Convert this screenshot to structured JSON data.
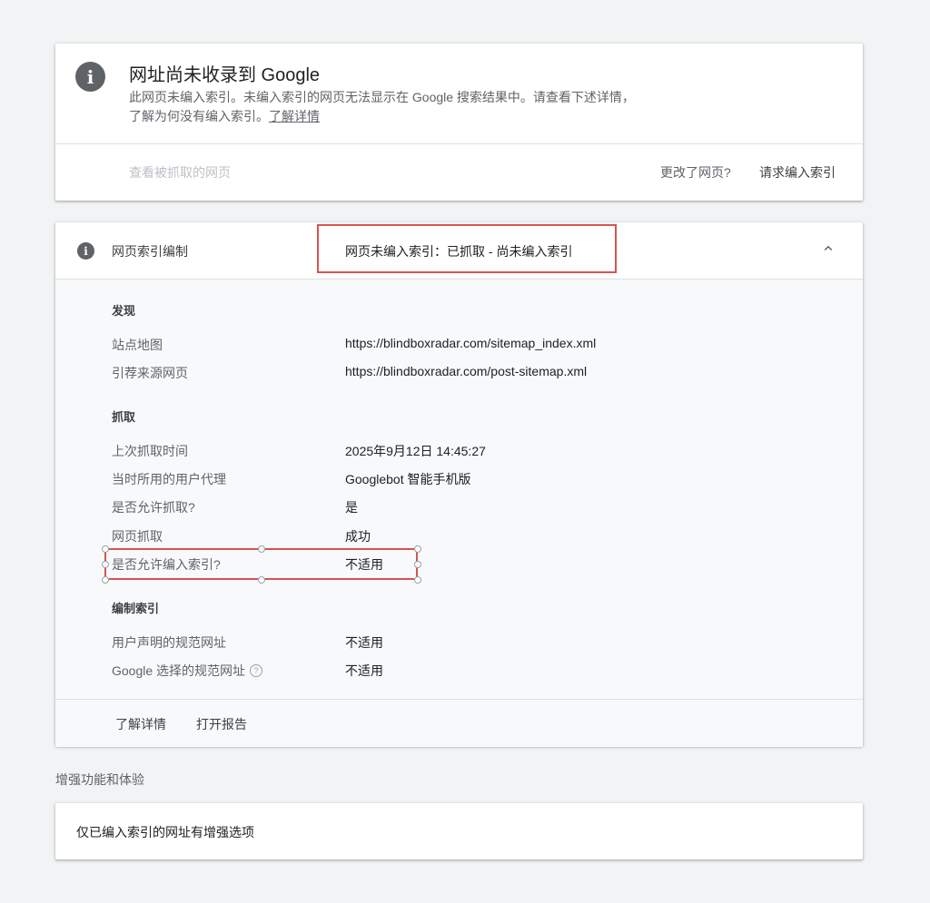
{
  "summary_card": {
    "title": "网址尚未收录到 Google",
    "description": "此网页未编入索引。未编入索引的网页无法显示在 Google 搜索结果中。请查看下述详情，了解为何没有编入索引。",
    "learn_more_link": "了解详情",
    "view_crawled_page": "查看被抓取的网页",
    "page_changed": "更改了网页?",
    "request_indexing": "请求编入索引"
  },
  "indexing_card": {
    "label": "网页索引编制",
    "status": "网页未编入索引：已抓取 - 尚未编入索引",
    "sections": {
      "discovery": {
        "title": "发现",
        "rows": [
          {
            "label": "站点地图",
            "value": "https://blindboxradar.com/sitemap_index.xml"
          },
          {
            "label": "引荐来源网页",
            "value": "https://blindboxradar.com/post-sitemap.xml"
          }
        ]
      },
      "crawl": {
        "title": "抓取",
        "rows": [
          {
            "label": "上次抓取时间",
            "value": "2025年9月12日 14:45:27"
          },
          {
            "label": "当时所用的用户代理",
            "value": "Googlebot 智能手机版"
          },
          {
            "label": "是否允许抓取?",
            "value": "是"
          },
          {
            "label": "网页抓取",
            "value": "成功"
          },
          {
            "label": "是否允许编入索引?",
            "value": "不适用"
          }
        ]
      },
      "indexing": {
        "title": "编制索引",
        "rows": [
          {
            "label": "用户声明的规范网址",
            "value": "不适用"
          },
          {
            "label": "Google 选择的规范网址",
            "value": "不适用"
          }
        ]
      }
    },
    "footer": {
      "learn_more": "了解详情",
      "open_report": "打开报告"
    }
  },
  "enhancements": {
    "heading": "增强功能和体验",
    "message": "仅已编入索引的网址有增强选项"
  },
  "icons": {
    "info": "info-icon",
    "chevron": "chevron-up-icon",
    "help": "help-icon"
  },
  "colors": {
    "highlight": "#d9534f",
    "icon_gray": "#5f6368"
  }
}
